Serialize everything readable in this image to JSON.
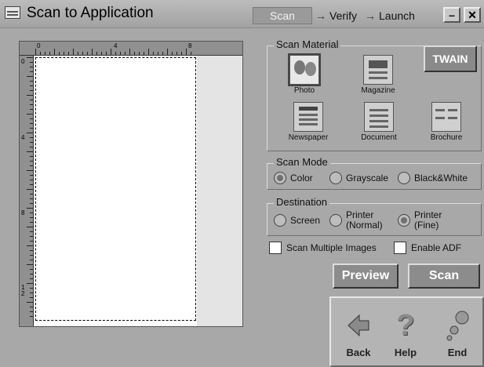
{
  "window": {
    "title": "Scan to Application",
    "steps": [
      "Scan",
      "Verify",
      "Launch"
    ],
    "arrow": "→",
    "minimize": "–",
    "close": "✕"
  },
  "preview": {
    "ruler_top_labels": [
      "0",
      "4",
      "8"
    ],
    "ruler_left_labels": [
      "0",
      "4",
      "8",
      "1\n2"
    ]
  },
  "scan_material": {
    "label": "Scan Material",
    "items": [
      {
        "label": "Photo",
        "icon": "photo-icon",
        "selected": true
      },
      {
        "label": "Magazine",
        "icon": "magazine-icon",
        "selected": false
      },
      {
        "label": "Newspaper",
        "icon": "newspaper-icon",
        "selected": false
      },
      {
        "label": "Document",
        "icon": "document-icon",
        "selected": false
      },
      {
        "label": "Brochure",
        "icon": "brochure-icon",
        "selected": false
      }
    ]
  },
  "twain": "TWAIN",
  "scan_mode": {
    "label": "Scan Mode",
    "options": [
      "Color",
      "Grayscale",
      "Black&White"
    ],
    "selected": "Color"
  },
  "destination": {
    "label": "Destination",
    "options": [
      "Screen",
      "Printer\n(Normal)",
      "Printer\n(Fine)"
    ],
    "selected": "Printer (Fine)"
  },
  "checks": {
    "multi": "Scan Multiple Images",
    "adf": "Enable ADF"
  },
  "actions": {
    "preview": "Preview",
    "scan": "Scan"
  },
  "nav": {
    "back": "Back",
    "help": "Help",
    "end": "End"
  }
}
